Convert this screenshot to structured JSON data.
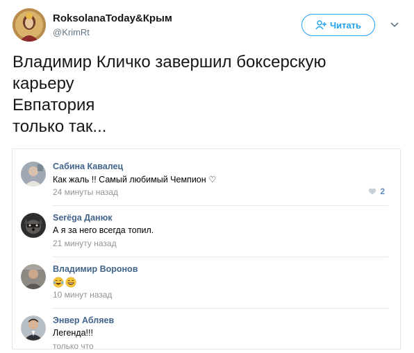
{
  "tweet": {
    "author_name": "RoksolanaToday&Крым",
    "author_handle": "@KrimRt",
    "follow_label": "Читать",
    "lines": [
      "Владимир Кличко завершил боксерскую",
      "карьеру",
      "Евпатория",
      "только так..."
    ]
  },
  "comments": [
    {
      "author": "Сабина Кавалец",
      "text": "Как жаль !! Самый любимый Чемпион ♡",
      "time": "24 минуты назад",
      "likes": "2"
    },
    {
      "author": "Serёga Данюк",
      "text": "А я за него всегда топил.",
      "time": "21 минуту назад"
    },
    {
      "author": "Владимир Воронов",
      "emojis": [
        "laughing-tears-emoji",
        "grinning-emoji"
      ],
      "time": "10 минут назад"
    },
    {
      "author": "Энвер Абляев",
      "text": "Легенда!!!",
      "time": "только что"
    }
  ],
  "colors": {
    "twitter_blue": "#1da1f2",
    "vk_link": "#42648b",
    "vk_meta": "#939393"
  }
}
